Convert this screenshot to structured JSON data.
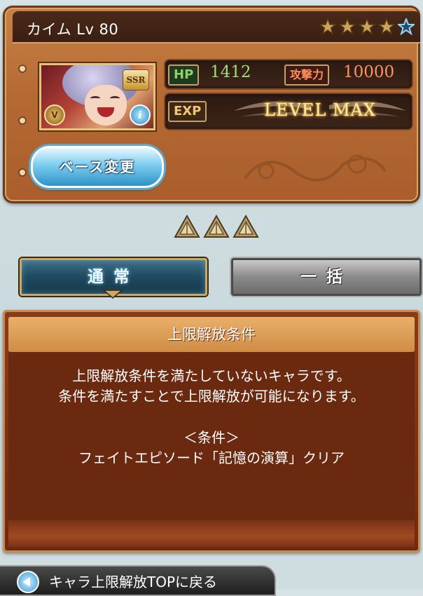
{
  "character": {
    "name": "カイム Lv 80",
    "rarity": "SSR",
    "stars_filled": 4,
    "stars_total": 5,
    "element_icon": "earth-element-icon",
    "info_icon": "i"
  },
  "stats": {
    "hp_label": "HP",
    "hp_value": "1412",
    "atk_label": "攻撃力",
    "atk_value": "10000",
    "exp_label": "EXP",
    "exp_status": "LEVEL MAX"
  },
  "buttons": {
    "base_change": "ベース変更"
  },
  "uncap": {
    "count": 3
  },
  "tabs": [
    {
      "label": "通常",
      "active": true
    },
    {
      "label": "一括",
      "active": false
    }
  ],
  "condition": {
    "title": "上限解放条件",
    "line1": "上限解放条件を満たしていないキャラです。",
    "line2": "条件を満たすことで上限解放が可能になります。",
    "cond_heading": "＜条件＞",
    "cond_detail": "フェイトエピソード「記憶の演算」クリア"
  },
  "nav": {
    "back_label": "キャラ上限解放TOPに戻る"
  },
  "colors": {
    "panel_brown": "#b56a33",
    "hp_green": "#9edc78",
    "atk_orange": "#ff9264",
    "accent_blue": "#2f92c6"
  }
}
